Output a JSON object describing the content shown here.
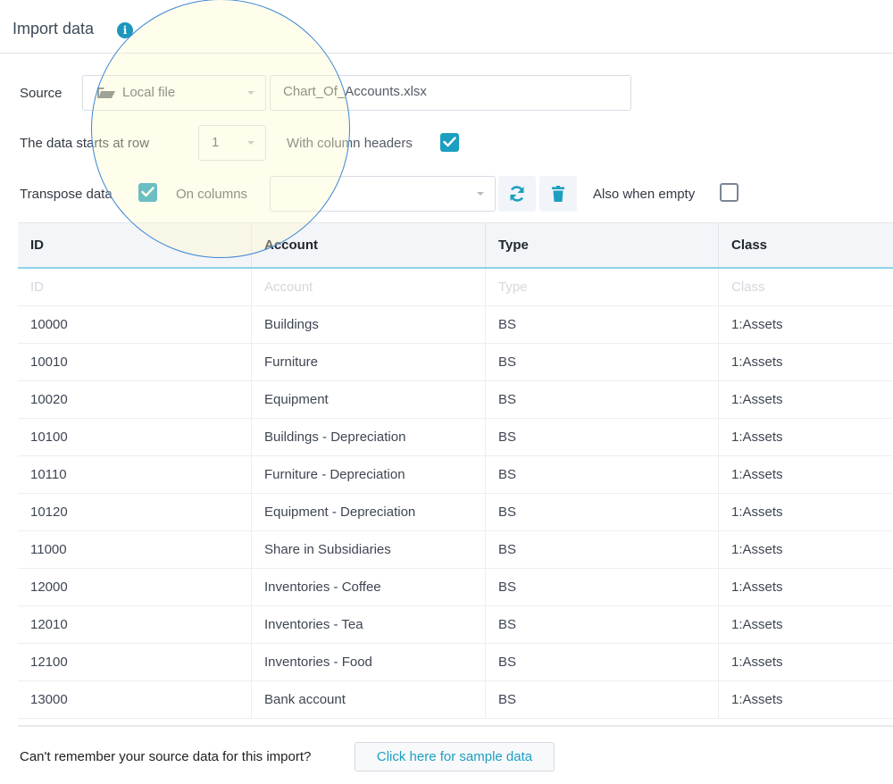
{
  "header": {
    "title": "Import data",
    "info_icon": "info-icon"
  },
  "form": {
    "source_label": "Source",
    "source_select": {
      "value": "Local file",
      "icon": "folder-open-icon"
    },
    "file_name": "Chart_Of_Accounts.xlsx",
    "start_row_label": "The data starts at row",
    "start_row_value": "1",
    "column_headers_label": "With column headers",
    "column_headers_checked": true,
    "transpose_label": "Transpose data",
    "transpose_checked": true,
    "on_columns_label": "On columns",
    "on_columns_value": "",
    "refresh_icon": "refresh-icon",
    "delete_icon": "trash-icon",
    "also_when_empty_label": "Also when empty",
    "also_when_empty_checked": false
  },
  "table": {
    "columns": [
      "ID",
      "Account",
      "Type",
      "Class"
    ],
    "placeholder_row": [
      "ID",
      "Account",
      "Type",
      "Class"
    ],
    "rows": [
      [
        "10000",
        "Buildings",
        "BS",
        "1:Assets"
      ],
      [
        "10010",
        "Furniture",
        "BS",
        "1:Assets"
      ],
      [
        "10020",
        "Equipment",
        "BS",
        "1:Assets"
      ],
      [
        "10100",
        "Buildings - Depreciation",
        "BS",
        "1:Assets"
      ],
      [
        "10110",
        "Furniture - Depreciation",
        "BS",
        "1:Assets"
      ],
      [
        "10120",
        "Equipment - Depreciation",
        "BS",
        "1:Assets"
      ],
      [
        "11000",
        "Share in Subsidiaries",
        "BS",
        "1:Assets"
      ],
      [
        "12000",
        "Inventories - Coffee",
        "BS",
        "1:Assets"
      ],
      [
        "12010",
        "Inventories - Tea",
        "BS",
        "1:Assets"
      ],
      [
        "12100",
        "Inventories - Food",
        "BS",
        "1:Assets"
      ],
      [
        "13000",
        "Bank account",
        "BS",
        "1:Assets"
      ]
    ]
  },
  "footer": {
    "question": "Can't remember your source data for this import?",
    "sample_button": "Click here for sample data"
  },
  "colors": {
    "accent": "#1c9fc0",
    "header_border": "#8ed3e6",
    "highlight_outline": "#3b86d4"
  }
}
